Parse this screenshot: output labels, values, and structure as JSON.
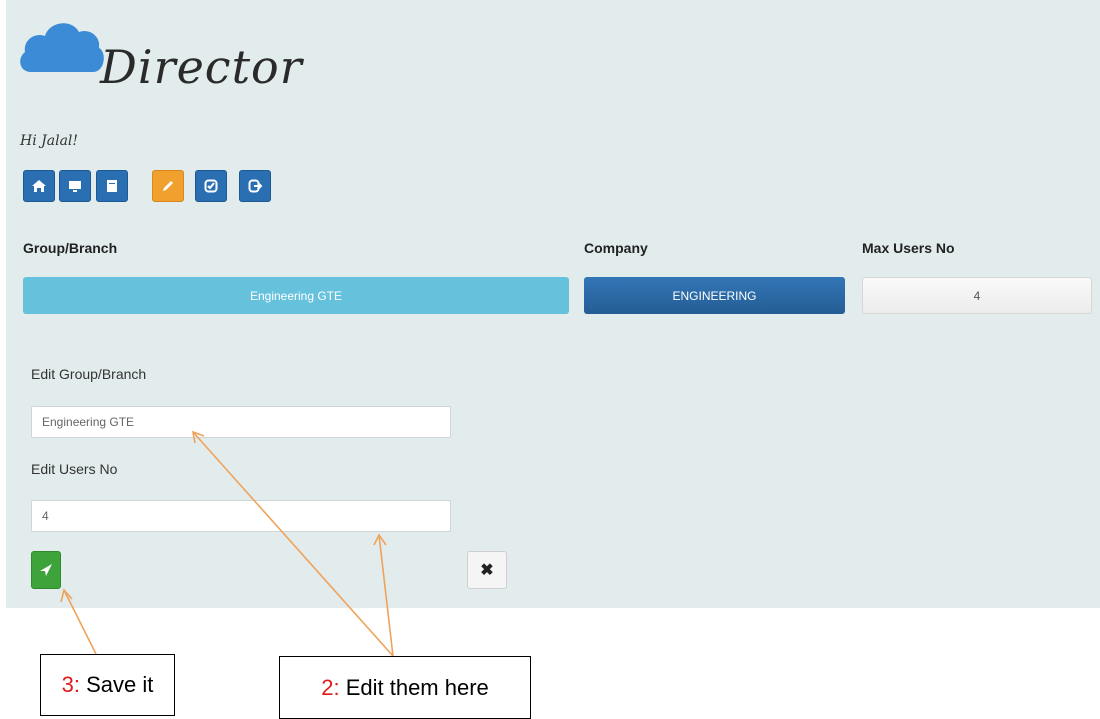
{
  "brand": {
    "logo_text": "Director",
    "greeting": "Hi Jalal!"
  },
  "toolbar": {
    "buttons": [
      {
        "icon": "home-icon"
      },
      {
        "icon": "monitor-icon"
      },
      {
        "icon": "document-icon"
      },
      {
        "icon": "pencil-icon",
        "active": true
      },
      {
        "icon": "checklist-icon"
      },
      {
        "icon": "logout-icon"
      }
    ]
  },
  "summary": {
    "group_header": "Group/Branch",
    "company_header": "Company",
    "max_users_header": "Max Users No",
    "group_value": "Engineering GTE",
    "company_value": "ENGINEERING",
    "max_users_value": "4"
  },
  "edit_form": {
    "group_label": "Edit Group/Branch",
    "group_value": "Engineering GTE",
    "users_label": "Edit Users No",
    "users_value": "4",
    "save_icon": "send-icon",
    "cancel_icon": "close-icon"
  },
  "annotations": {
    "save": {
      "num": "3:",
      "text": "Save it"
    },
    "edit": {
      "num": "2:",
      "text": "Edit them here"
    }
  },
  "colors": {
    "panel_bg": "#e2eced",
    "toolbar_blue": "#2a6fb1",
    "toolbar_active": "#f0a02c",
    "group_bar": "#66c1dd",
    "company_bar": "#2b6ba9",
    "save_green": "#3fa33c",
    "arrow_orange": "#f0a25a",
    "callout_number_red": "#e11a1a"
  }
}
